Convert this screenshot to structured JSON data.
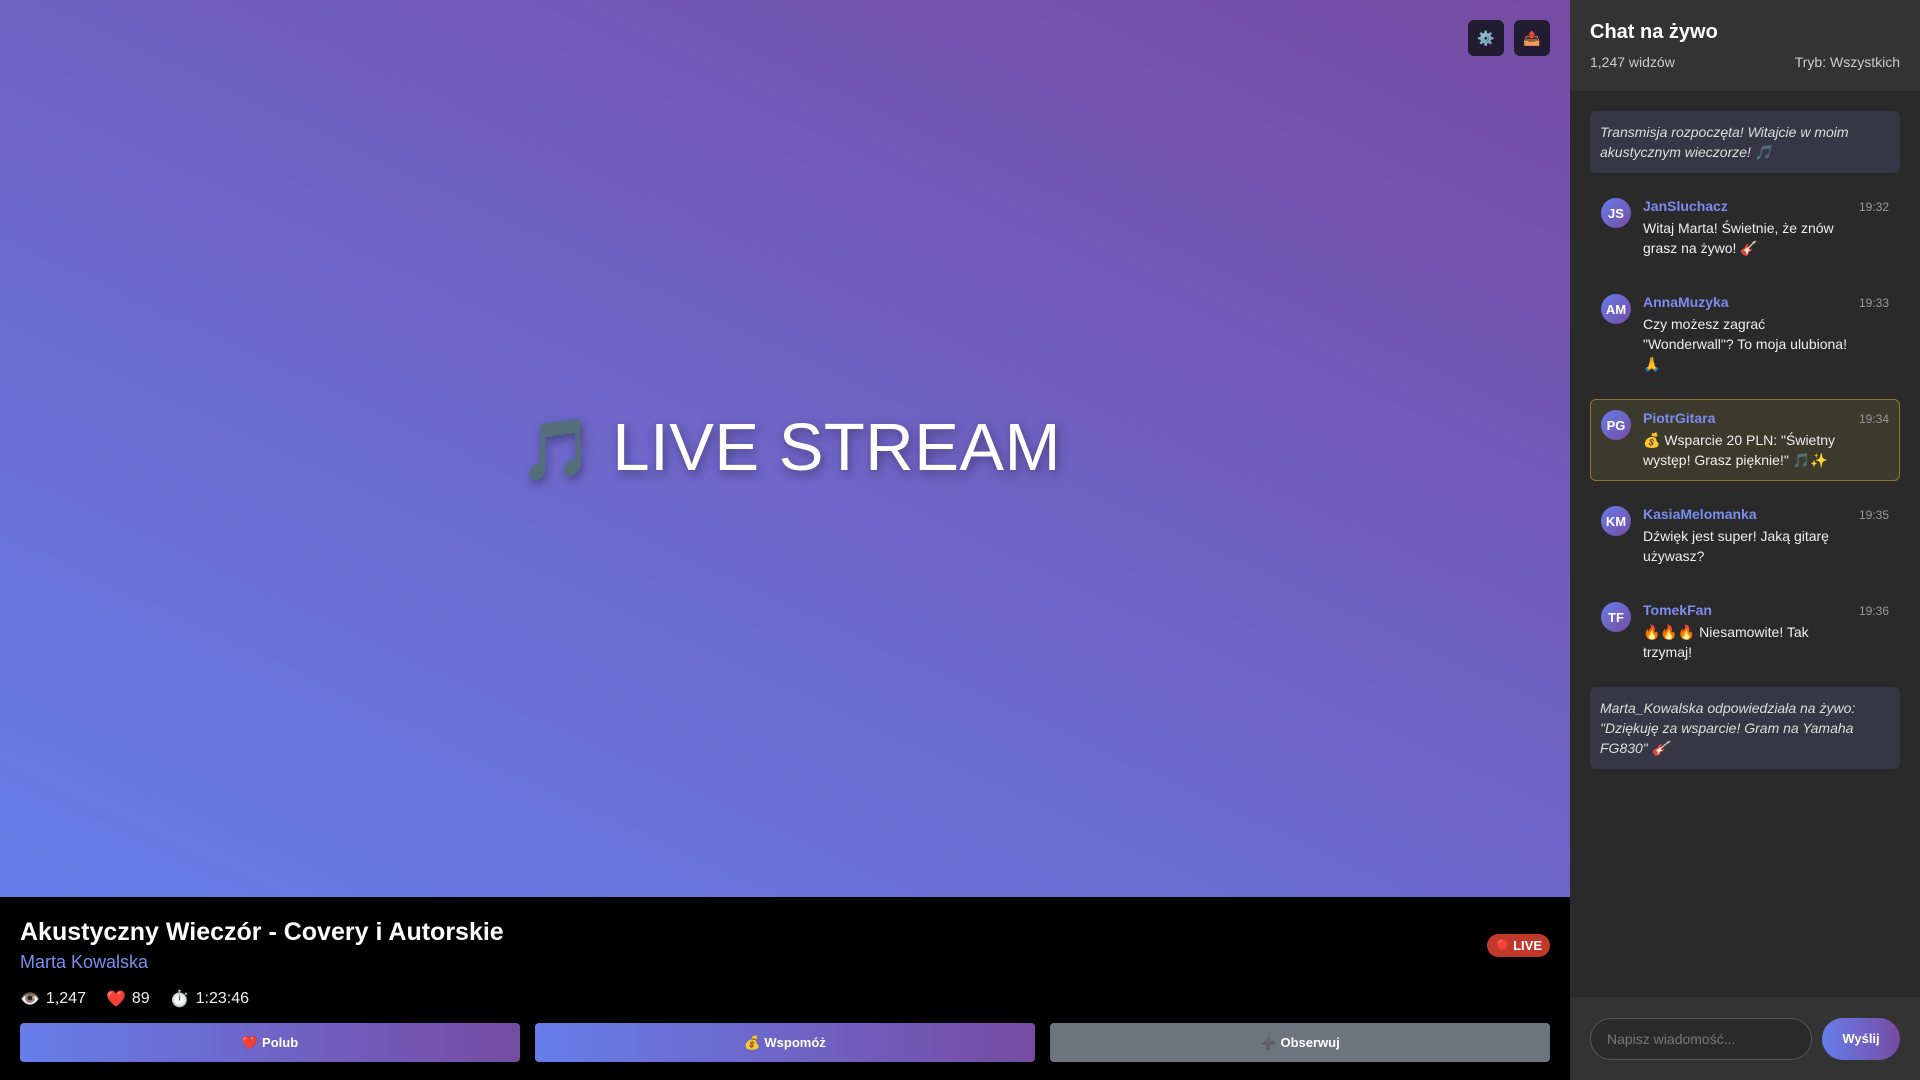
{
  "video": {
    "title_icon": "🎵",
    "title": "LIVE STREAM",
    "controls": [
      {
        "icon": "⚙️",
        "name": "settings-icon"
      },
      {
        "icon": "📤",
        "name": "share-icon"
      }
    ]
  },
  "stream": {
    "title": "Akustyczny Wieczór - Covery i Autorskie",
    "streamer": "Marta Kowalska",
    "live_badge_icon": "🔴",
    "live_badge": "LIVE",
    "stats": {
      "viewers_icon": "👁️",
      "viewers": "1,247",
      "likes_icon": "❤️",
      "likes": "89",
      "duration_icon": "⏱️",
      "duration": "1:23:46"
    },
    "actions": {
      "like_icon": "❤️",
      "like": "Polub",
      "donate_icon": "💰",
      "donate": "Wspomóż",
      "follow_icon": "➕",
      "follow": "Obserwuj"
    }
  },
  "chat": {
    "title": "Chat na żywo",
    "viewers": "1,247 widzów",
    "mode": "Tryb: Wszystkich",
    "system_start": "Transmisja rozpoczęta! Witajcie w moim akustycznym wieczorze! 🎵",
    "messages": [
      {
        "initials": "JS",
        "user": "JanSluchacz",
        "time": "19:32",
        "text": "Witaj Marta! Świetnie, że znów grasz na żywo! 🎸"
      },
      {
        "initials": "AM",
        "user": "AnnaMuzyka",
        "time": "19:33",
        "text": "Czy możesz zagrać \"Wonderwall\"? To moja ulubiona! 🙏"
      },
      {
        "initials": "PG",
        "user": "PiotrGitara",
        "time": "19:34",
        "text": "💰 Wsparcie 20 PLN: \"Świetny występ! Grasz pięknie!\" 🎵✨"
      },
      {
        "initials": "KM",
        "user": "KasiaMelomanka",
        "time": "19:35",
        "text": "Dźwięk jest super! Jaką gitarę używasz?"
      },
      {
        "initials": "TF",
        "user": "TomekFan",
        "time": "19:36",
        "text": "🔥🔥🔥 Niesamowite! Tak trzymaj!"
      }
    ],
    "system_reply": "Marta_Kowalska odpowiedziała na żywo: \"Dziękuję za wsparcie! Gram na Yamaha FG830\" 🎸",
    "input_placeholder": "Napisz wiadomość...",
    "send": "Wyślij"
  }
}
